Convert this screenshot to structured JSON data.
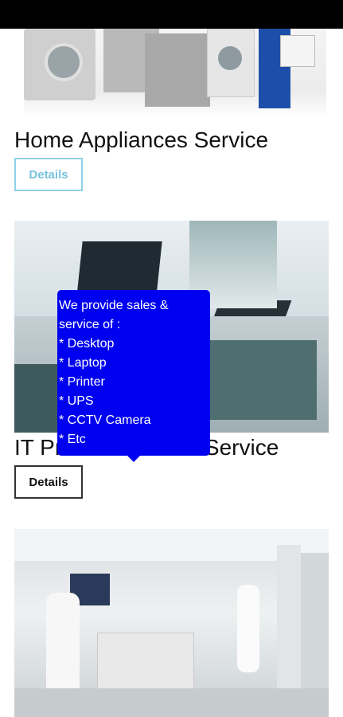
{
  "cards": [
    {
      "image_name": "home-appliances-image",
      "title": "Home Appliances Service",
      "details_label": "Details"
    },
    {
      "image_name": "it-products-image",
      "title": "IT Products & Service",
      "visible_title_start": "IT Pr",
      "visible_title_end": "k Service",
      "details_label": "Details"
    },
    {
      "image_name": "laboratory-image"
    }
  ],
  "tooltip": {
    "lines": [
      "We provide sales &",
      "service of :",
      "* Desktop",
      "* Laptop",
      "* Printer",
      "* UPS",
      "* CCTV Camera",
      "* Etc"
    ]
  }
}
